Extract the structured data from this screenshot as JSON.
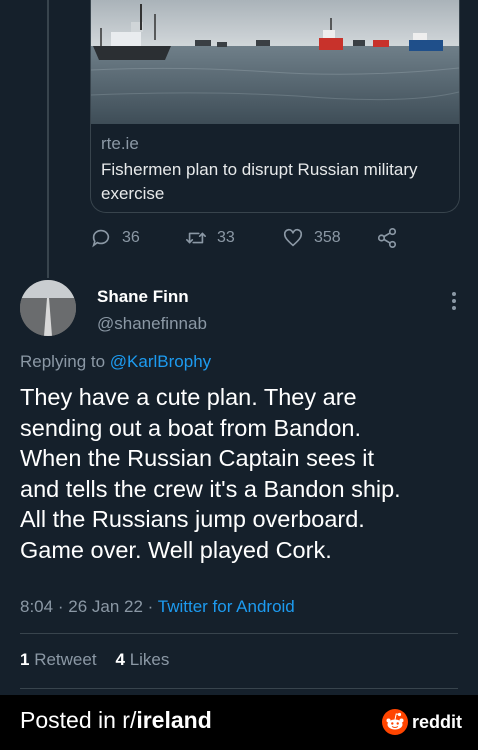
{
  "link_card": {
    "domain": "rte.ie",
    "title": "Fishermen plan to disrupt Russian military exercise"
  },
  "quoted_actions": {
    "replies": "36",
    "retweets": "33",
    "likes": "358"
  },
  "tweet": {
    "display_name": "Shane Finn",
    "handle": "@shanefinnab",
    "replying_prefix": "Replying to",
    "replying_to": "@KarlBrophy",
    "text": "They have a cute plan. They are\nsending out a boat from Bandon.\nWhen the Russian Captain sees it\nand tells the crew it's a Bandon ship.\nAll the Russians jump overboard.\nGame over.  Well played Cork.",
    "time": "8:04",
    "date": "26 Jan 22",
    "separator": "·",
    "client": "Twitter for Android",
    "retweet_count": "1",
    "retweet_label": "Retweet",
    "like_count": "4",
    "like_label": "Likes"
  },
  "footer": {
    "posted_in": "Posted in r/",
    "subreddit": "ireland",
    "brand": "reddit"
  },
  "colors": {
    "background": "#15202b",
    "link": "#1d9bf0",
    "muted": "#8b98a5",
    "reddit_orange": "#ff4500"
  }
}
